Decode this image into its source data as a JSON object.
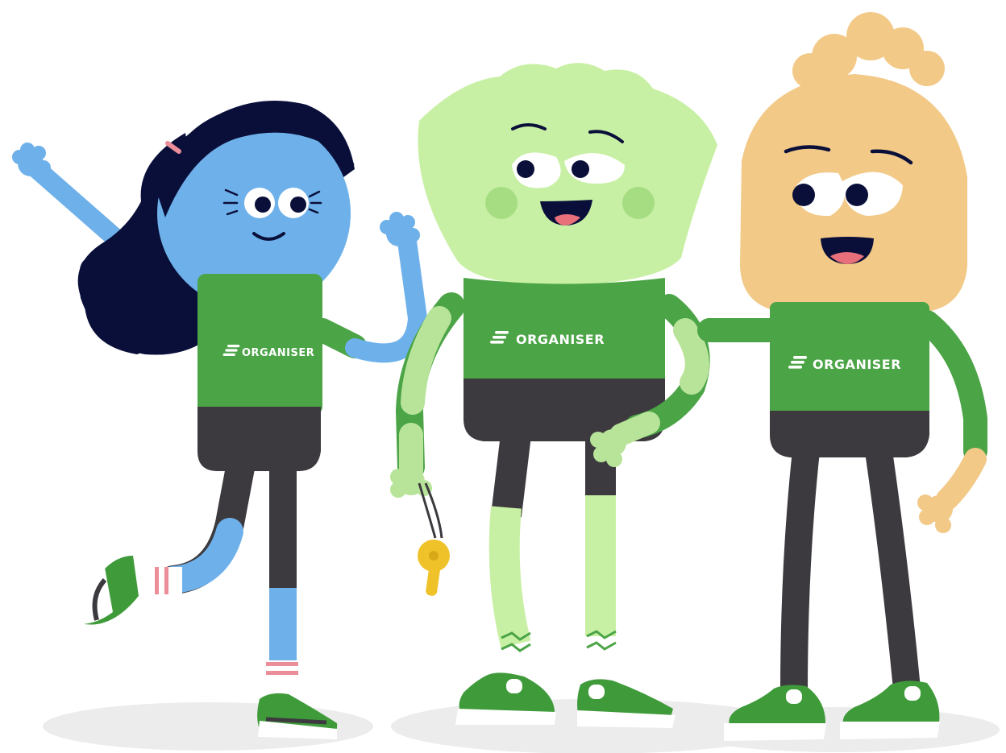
{
  "shirt_text": "ORGANISER",
  "logo_icon": "organiser-logo-icon",
  "colors": {
    "shirt_green": "#4ba446",
    "shoe_green": "#3f9b3a",
    "pants_dark": "#3d3a3f",
    "blue_skin": "#6eb1ea",
    "green_skin": "#c8f0a4",
    "tan_skin": "#f2c987",
    "hair_navy": "#0a0f3a",
    "whistle_yellow": "#f0c22a",
    "shadow_gray": "#ececec",
    "mouth_pink": "#e8707a",
    "white": "#ffffff"
  },
  "characters": [
    {
      "name": "blue-character",
      "pose": "waving"
    },
    {
      "name": "green-character",
      "pose": "holding-whistle"
    },
    {
      "name": "tan-character",
      "pose": "arm-around-friend"
    }
  ]
}
